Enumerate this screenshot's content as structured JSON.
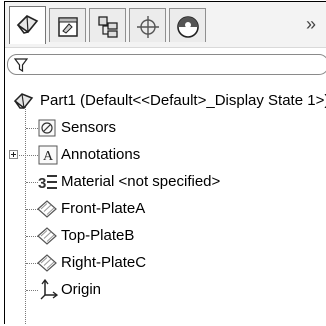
{
  "toolbar": {
    "tabs": [
      {
        "icon": "feature-manager-icon"
      },
      {
        "icon": "property-manager-icon"
      },
      {
        "icon": "configuration-manager-icon"
      },
      {
        "icon": "dimxpert-manager-icon"
      },
      {
        "icon": "display-manager-icon"
      }
    ],
    "overflow_label": "»"
  },
  "filter": {
    "icon": "filter-icon",
    "value": ""
  },
  "tree": {
    "root_label": "Part1  (Default<<Default>_Display State 1>)",
    "items": [
      {
        "label": "Sensors",
        "icon": "sensors-icon"
      },
      {
        "label": "Annotations",
        "icon": "annotations-icon"
      },
      {
        "label": "Material <not specified>",
        "icon": "material-icon"
      },
      {
        "label": "Front-PlateA",
        "icon": "plane-icon"
      },
      {
        "label": "Top-PlateB",
        "icon": "plane-icon"
      },
      {
        "label": "Right-PlateC",
        "icon": "plane-icon"
      },
      {
        "label": "Origin",
        "icon": "origin-icon"
      }
    ]
  }
}
